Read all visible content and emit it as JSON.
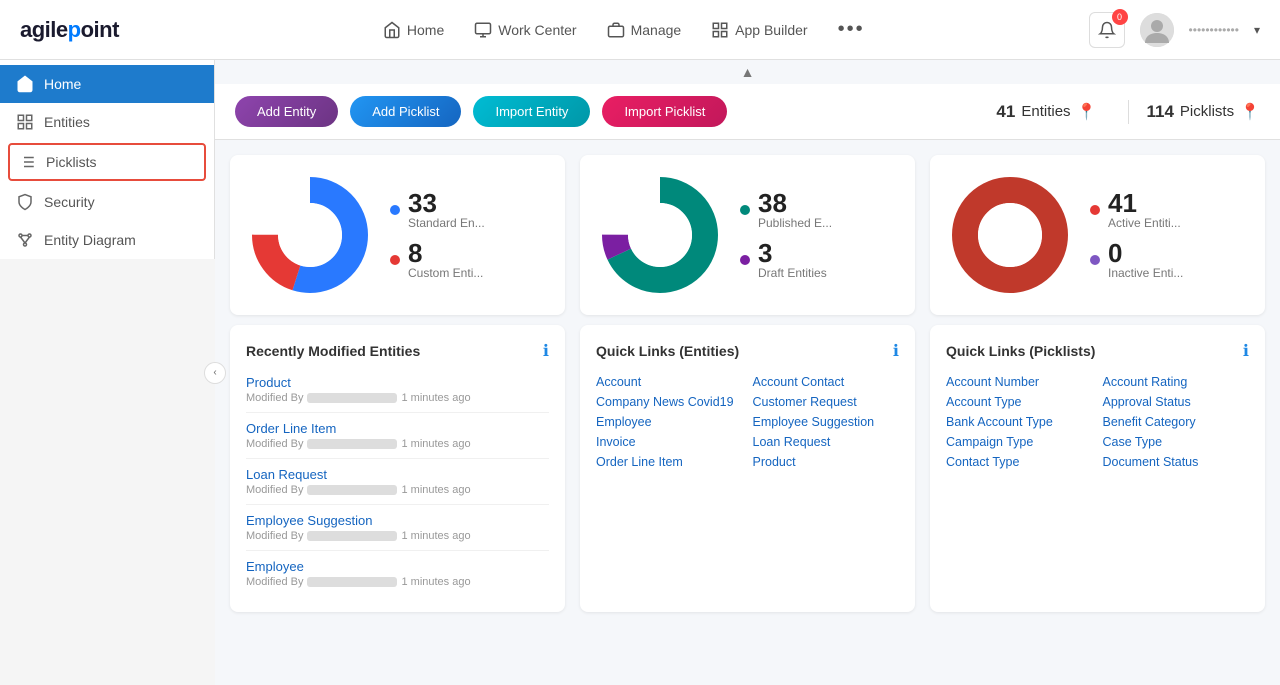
{
  "app": {
    "logo": "agilepoint"
  },
  "topnav": {
    "items": [
      {
        "label": "Home",
        "icon": "home-icon"
      },
      {
        "label": "Work Center",
        "icon": "monitor-icon"
      },
      {
        "label": "Manage",
        "icon": "briefcase-icon"
      },
      {
        "label": "App Builder",
        "icon": "grid-icon"
      }
    ],
    "more_label": "•••",
    "notif_count": "0",
    "user_name": "••••••••••••",
    "chevron": "▾"
  },
  "sidebar": {
    "items": [
      {
        "label": "Home",
        "icon": "home-icon"
      },
      {
        "label": "Entities",
        "icon": "entities-icon"
      },
      {
        "label": "Picklists",
        "icon": "picklists-icon"
      },
      {
        "label": "Security",
        "icon": "security-icon"
      },
      {
        "label": "Entity Diagram",
        "icon": "diagram-icon"
      }
    ]
  },
  "toolbar": {
    "add_entity": "Add Entity",
    "add_picklist": "Add Picklist",
    "import_entity": "Import Entity",
    "import_picklist": "Import Picklist",
    "entities_count": "41",
    "entities_label": "Entities",
    "picklists_count": "114",
    "picklists_label": "Picklists"
  },
  "charts": [
    {
      "segments": [
        {
          "value": 33,
          "color": "#2979FF",
          "label": "Standard En..."
        },
        {
          "value": 8,
          "color": "#e53935",
          "label": "Custom Enti..."
        }
      ],
      "center_color": "#fff"
    },
    {
      "segments": [
        {
          "value": 38,
          "color": "#00897B",
          "label": "Published E..."
        },
        {
          "value": 3,
          "color": "#7B1FA2",
          "label": "Draft Entities"
        }
      ],
      "center_color": "#fff"
    },
    {
      "segments": [
        {
          "value": 41,
          "color": "#c0392b",
          "label": "Active Entiti..."
        },
        {
          "value": 0,
          "color": "#7E57C2",
          "label": "Inactive Enti..."
        }
      ],
      "center_color": "#fff"
    }
  ],
  "recently_modified": {
    "title": "Recently Modified Entities",
    "items": [
      {
        "name": "Product",
        "time": "1 minutes ago"
      },
      {
        "name": "Order Line Item",
        "time": "1 minutes ago"
      },
      {
        "name": "Loan Request",
        "time": "1 minutes ago"
      },
      {
        "name": "Employee Suggestion",
        "time": "1 minutes ago"
      },
      {
        "name": "Employee",
        "time": "1 minutes ago"
      }
    ]
  },
  "quick_links_entities": {
    "title": "Quick Links (Entities)",
    "links": [
      "Account",
      "Account Contact",
      "Company News Covid19",
      "Customer Request",
      "Employee",
      "Employee Suggestion",
      "Invoice",
      "Loan Request",
      "Order Line Item",
      "Product"
    ]
  },
  "quick_links_picklists": {
    "title": "Quick Links (Picklists)",
    "links": [
      "Account Number",
      "Account Rating",
      "Account Type",
      "Approval Status",
      "Bank Account Type",
      "Benefit Category",
      "Campaign Type",
      "Case Type",
      "Contact Type",
      "Document Status"
    ]
  }
}
